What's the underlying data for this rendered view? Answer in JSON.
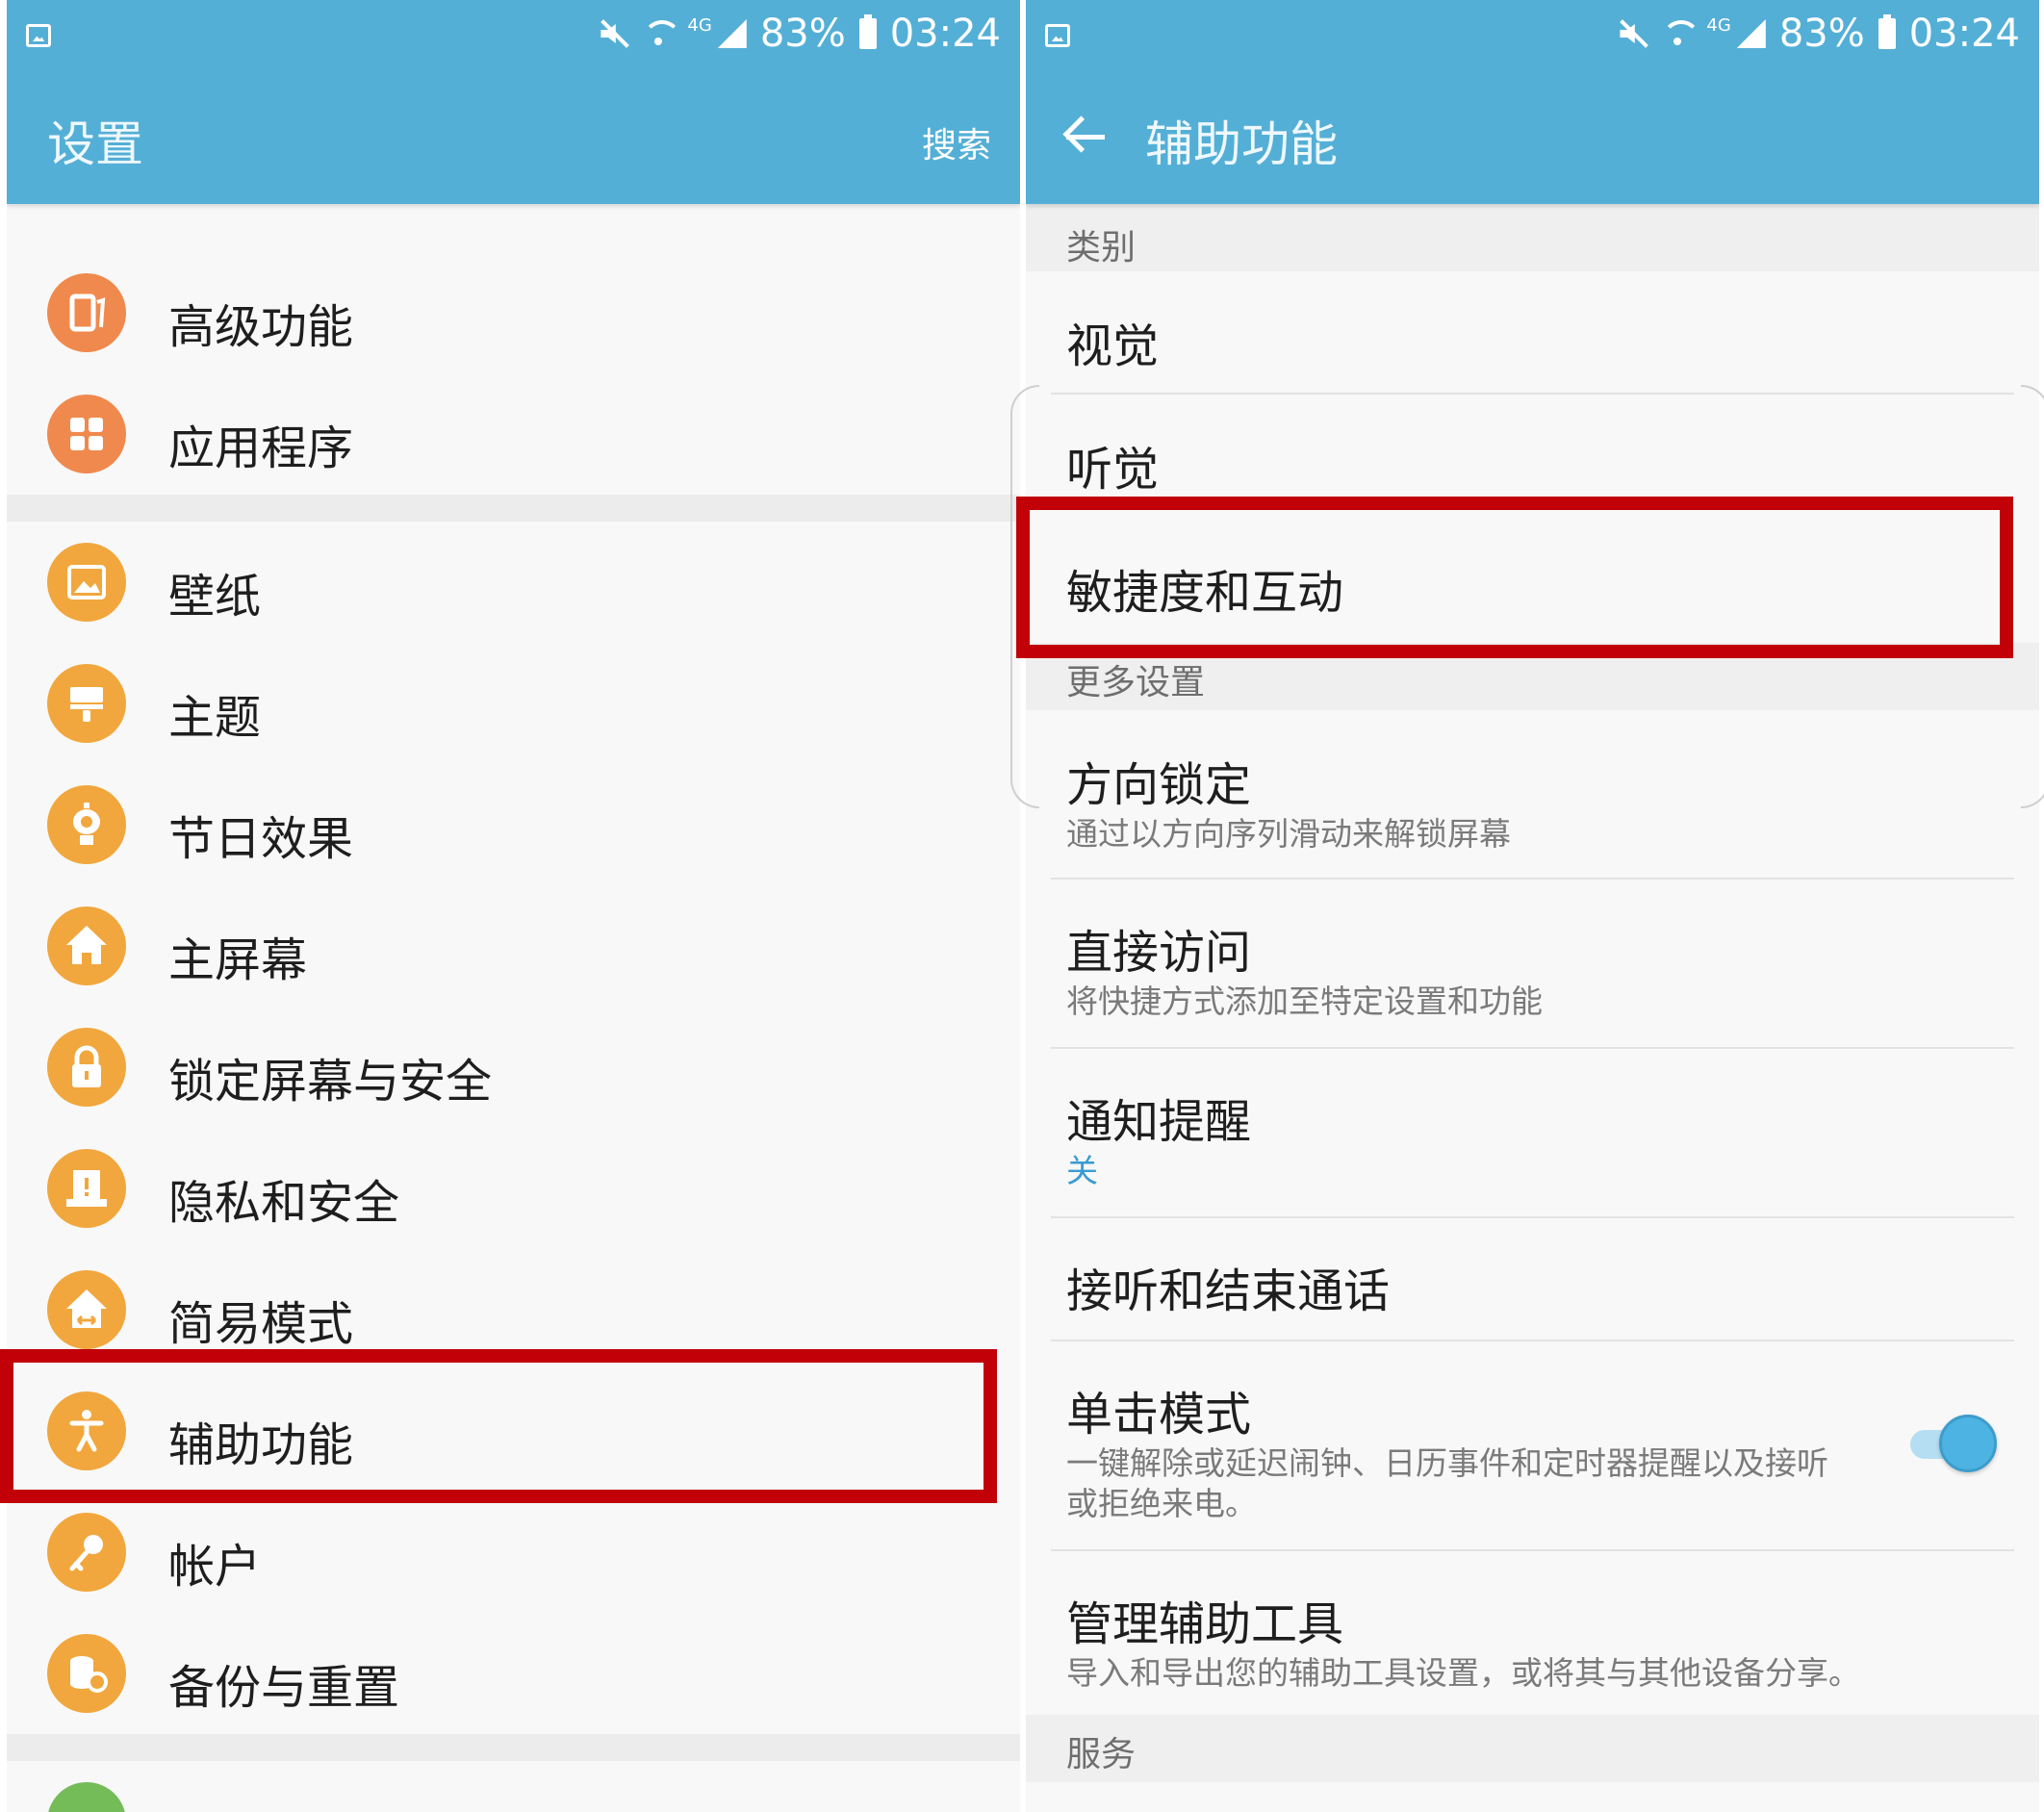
{
  "left": {
    "status": {
      "net": "4G",
      "battery": "83%",
      "time": "03:24"
    },
    "title": "设置",
    "search": "搜索",
    "items": [
      {
        "label": "高级功能",
        "icon": "advanced-features-icon"
      },
      {
        "label": "应用程序",
        "icon": "apps-grid-icon"
      },
      {
        "label": "壁纸",
        "icon": "wallpaper-icon"
      },
      {
        "label": "主题",
        "icon": "theme-brush-icon"
      },
      {
        "label": "节日效果",
        "icon": "festival-lantern-icon"
      },
      {
        "label": "主屏幕",
        "icon": "home-icon"
      },
      {
        "label": "锁定屏幕与安全",
        "icon": "lock-icon"
      },
      {
        "label": "隐私和安全",
        "icon": "privacy-icon"
      },
      {
        "label": "简易模式",
        "icon": "easy-mode-icon"
      },
      {
        "label": "辅助功能",
        "icon": "accessibility-icon"
      },
      {
        "label": "帐户",
        "icon": "account-key-icon"
      },
      {
        "label": "备份与重置",
        "icon": "backup-reset-icon"
      }
    ]
  },
  "right": {
    "status": {
      "net": "4G",
      "battery": "83%",
      "time": "03:24"
    },
    "title": "辅助功能",
    "section_category": "类别",
    "categories": [
      "视觉",
      "听觉",
      "敏捷度和互动"
    ],
    "section_more": "更多设置",
    "more": [
      {
        "title": "方向锁定",
        "subtitle": "通过以方向序列滑动来解锁屏幕"
      },
      {
        "title": "直接访问",
        "subtitle": "将快捷方式添加至特定设置和功能"
      },
      {
        "title": "通知提醒",
        "subtitle": "关"
      },
      {
        "title": "接听和结束通话"
      },
      {
        "title": "单击模式",
        "subtitle_line1": "一键解除或延迟闹钟、日历事件和定时器提醒以及接听",
        "subtitle_line2": "或拒绝来电。",
        "toggle_on": true
      },
      {
        "title": "管理辅助工具",
        "subtitle": "导入和导出您的辅助工具设置，或将其与其他设备分享。"
      }
    ],
    "section_services": "服务"
  },
  "colors": {
    "header_blue": "#54afd6",
    "highlight_red": "#c10008",
    "icon_orange": "#f0894d",
    "icon_amber": "#f1a73d",
    "toggle_blue": "#4db3e2",
    "link_blue": "#3a9bd3"
  }
}
